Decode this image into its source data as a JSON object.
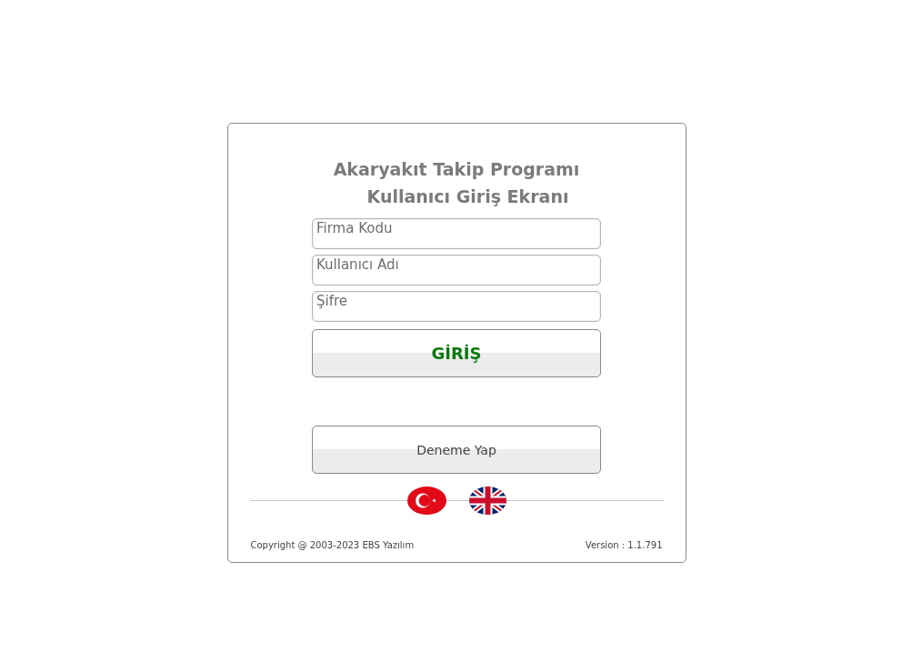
{
  "title_lines": [
    "Akaryakıt Takip Programı",
    "Kullanıcı Giriş Ekranı"
  ],
  "fields": [
    {
      "placeholder": "Firma Kodu"
    },
    {
      "placeholder": "Kullanıcı Adı"
    },
    {
      "placeholder": "Şifre"
    }
  ],
  "login_button": "GİRİŞ",
  "trial_button": "Deneme Yap",
  "languages": [
    {
      "kind": "tr"
    },
    {
      "kind": "en"
    }
  ],
  "footer": {
    "copyright": "Copyright @ 2003-2023 EBS Yazılım",
    "version": "Version : 1.1.791"
  }
}
